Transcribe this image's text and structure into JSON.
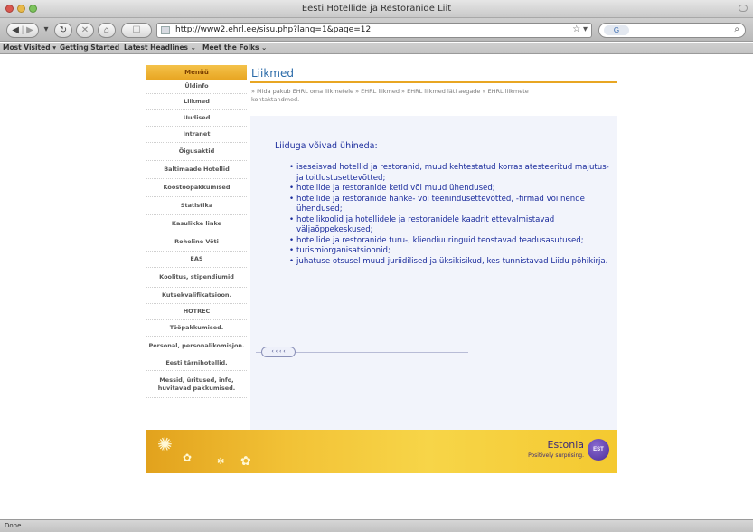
{
  "window": {
    "title": "Eesti Hotellide ja Restoranide Liit"
  },
  "toolbar": {
    "back_icon": "back-arrow-icon",
    "forward_icon": "forward-arrow-icon",
    "reload_icon": "reload-icon",
    "stop_icon": "stop-icon",
    "home_icon": "home-icon",
    "url": "http://www2.ehrl.ee/sisu.php?lang=1&page=12",
    "search_engine": "G"
  },
  "bookmarks": {
    "items": [
      "Most Visited ▾",
      "Getting Started",
      "Latest Headlines ⌄",
      "Meet the Folks ⌄"
    ]
  },
  "nav": {
    "header": "Menüü",
    "items": [
      "Üldinfo",
      "Liikmed",
      "Uudised",
      "Intranet",
      "Õigusaktid",
      "Baltimaade Hotellid",
      "Koostööpakkumised",
      "Statistika",
      "Kasulikke linke",
      "Roheline Võti",
      "EAS",
      "Koolitus, stipendiumid",
      "Kutsekvalifikatsioon.",
      "HOTREC",
      "Tööpakkumised.",
      "Personal, personalikomisjon.",
      "Eesti tärnihotellid.",
      "Messid, üritused, info, huvitavad pakkumised."
    ]
  },
  "main": {
    "title": "Liikmed",
    "breadcrumb": "» Mida pakub EHRL oma liikmetele » EHRL liikmed » EHRL liikmed läti aegade » EHRL liikmete kontaktandmed.",
    "intro": "Liiduga võivad ühineda:",
    "bullets": [
      "iseseisvad hotellid ja restoranid, muud kehtestatud korras atesteeritud majutus- ja toitlustusettevõtted;",
      "hotellide ja restoranide ketid või muud ühendused;",
      "hotellide ja restoranide hanke- või teenindusettevõtted, -firmad või nende ühendused;",
      "hotellikoolid ja hotellidele ja restoranidele kaadrit ettevalmistavad väljaõppekeskused;",
      "hotellide ja restoranide turu-, kliendiuuringuid teostavad teadusasutused;",
      "turismiorganisatsioonid;",
      "juhatuse otsusel muud juriidilised ja üksikisikud, kes tunnistavad Liidu põhikirja."
    ],
    "back_label": "‹ ‹ ‹ ‹"
  },
  "banner": {
    "brand": "Estonia",
    "tagline": "Positively surprising.",
    "logo_text": "EST"
  },
  "status": {
    "text": "Done"
  },
  "colors": {
    "accent": "#e8a623",
    "link_blue": "#1a2b9c",
    "title_blue": "#2a6aa8"
  }
}
